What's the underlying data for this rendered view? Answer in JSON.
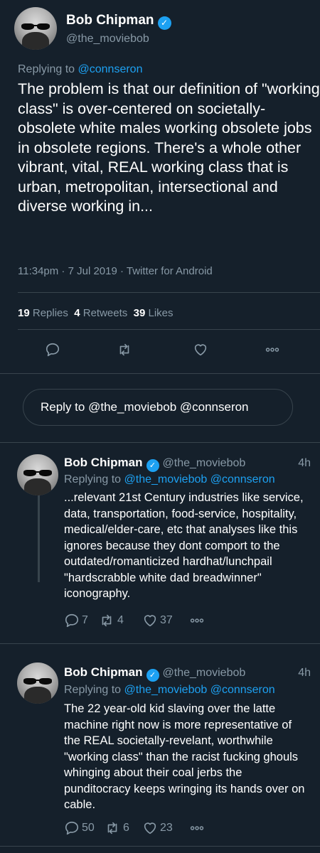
{
  "main_tweet": {
    "name": "Bob Chipman",
    "handle": "@the_moviebob",
    "replying_prefix": "Replying to ",
    "replying_to": "@connseron",
    "text": "The problem is that our definition of \"working class\" is over-centered on societally-obsolete white males working obsolete jobs in obsolete regions. There's a whole other vibrant, vital, REAL working class that is urban, metropolitan, intersectional and diverse working in...",
    "timestamp": "11:34pm · 7 Jul 2019 · Twitter for Android",
    "stats": {
      "replies_count": "19",
      "replies_label": "Replies",
      "retweets_count": "4",
      "retweets_label": "Retweets",
      "likes_count": "39",
      "likes_label": "Likes"
    },
    "icons": [
      "reply-icon",
      "retweet-icon",
      "like-icon",
      "more-icon"
    ]
  },
  "reply_box": {
    "placeholder": "Reply to @the_moviebob @connseron"
  },
  "replies": [
    {
      "name": "Bob Chipman",
      "handle": "@the_moviebob",
      "time": "4h",
      "replying_prefix": "Replying to ",
      "replying_to": "@the_moviebob @connseron",
      "text": "...relevant 21st Century industries like service, data, transportation, food-service, hospitality, medical/elder-care, etc that analyses like this ignores because they dont comport to the outdated/romanticized hardhat/lunchpail \"hardscrabble white dad breadwinner\" iconography.",
      "reply_count": "7",
      "retweet_count": "4",
      "like_count": "37"
    },
    {
      "name": "Bob Chipman",
      "handle": "@the_moviebob",
      "time": "4h",
      "replying_prefix": "Replying to ",
      "replying_to": "@the_moviebob @connseron",
      "text": "The 22 year-old kid slaving over the latte machine right now is more representative of the REAL societally-revelant, worthwhile \"working class\" than the racist fucking ghouls whinging about their coal jerbs the punditocracy keeps wringing its hands over on cable.",
      "reply_count": "50",
      "retweet_count": "6",
      "like_count": "23"
    }
  ],
  "colors": {
    "background": "#15202b",
    "accent": "#1da1f2",
    "muted": "#8899a6",
    "divider": "#38444d"
  }
}
